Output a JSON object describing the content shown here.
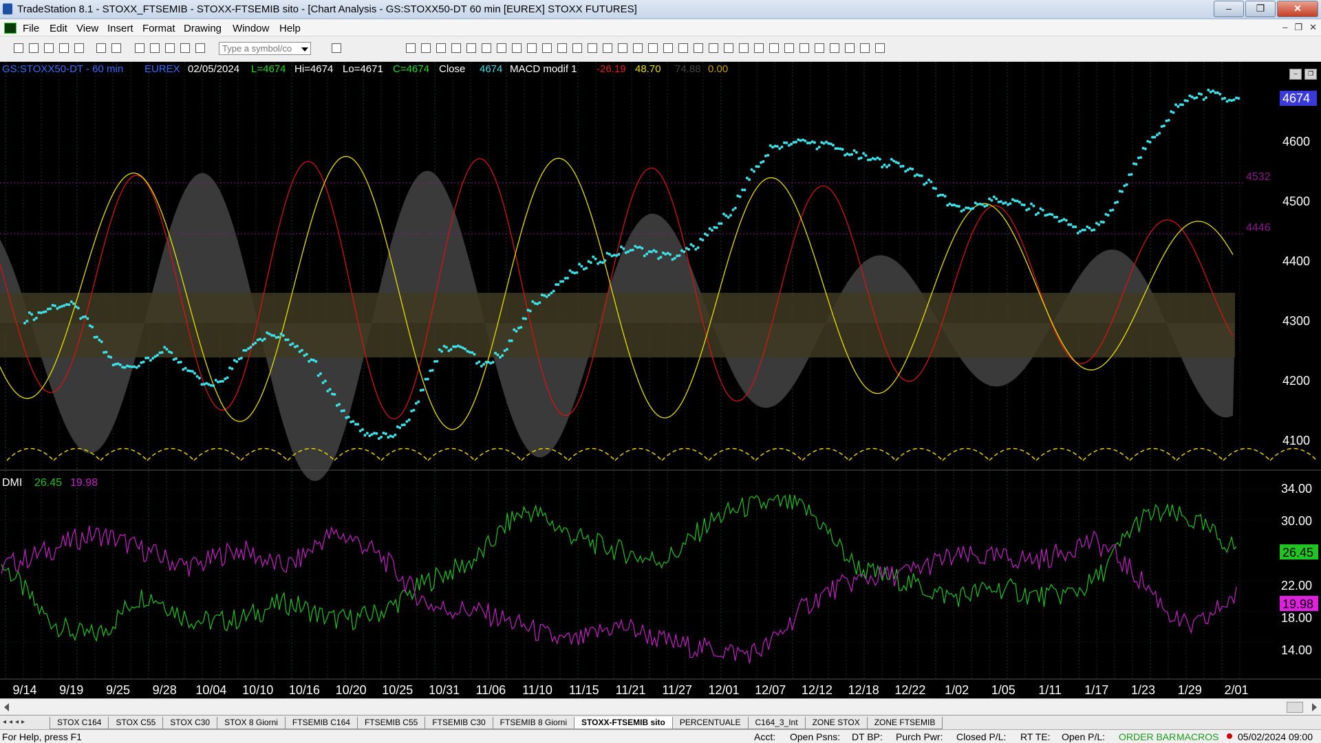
{
  "window": {
    "title": "TradeStation 8.1 - STOXX_FTSEMIB - STOXX-FTSEMIB sito - [Chart Analysis - GS:STOXX50-DT  60 min  [EUREX] STOXX FUTURES]",
    "minimize": "–",
    "restore": "❐",
    "close": "✕"
  },
  "menu": {
    "items": [
      "File",
      "Edit",
      "View",
      "Insert",
      "Format",
      "Drawing",
      "Window",
      "Help"
    ],
    "mdi_minimize": "–",
    "mdi_restore": "❐",
    "mdi_close": "✕"
  },
  "toolbar": {
    "symbol_placeholder": "Type a symbol/co"
  },
  "chart": {
    "header": {
      "symbol_interval": "GS:STOXX50-DT - 60 min",
      "exchange": "EUREX",
      "date": "02/05/2024",
      "last": "L=4674",
      "high": "Hi=4674",
      "low": "Lo=4671",
      "close_value": "C=4674",
      "close_label": "Close",
      "close_price": "4674",
      "macd_label": "MACD modif 1",
      "macd_v1": "-26.19",
      "macd_v2": "48.70",
      "macd_v3": "74.88",
      "macd_v4": "0.00"
    },
    "colors": {
      "price": "#3fe0e8",
      "macd_red": "#d41414",
      "macd_yellow": "#e8e000",
      "histogram": "#3a3a3a",
      "dmi_plus": "#22c422",
      "dmi_minus": "#c422c4",
      "level_line": "#9a1a9a"
    },
    "price_axis": {
      "ticks": [
        "4600",
        "4500",
        "4400",
        "4300",
        "4200",
        "4100"
      ],
      "last_price_tag": "4674",
      "level_high": "4532",
      "level_low": "4446"
    },
    "dmi": {
      "label": "DMI",
      "plus_value": "26.45",
      "minus_value": "19.98",
      "axis_ticks": [
        "34.00",
        "30.00",
        "22.00",
        "18.00",
        "14.00"
      ]
    },
    "x_axis": {
      "labels": [
        "9/14",
        "9/19",
        "9/25",
        "9/28",
        "10/04",
        "10/10",
        "10/16",
        "10/20",
        "10/25",
        "10/31",
        "11/06",
        "11/10",
        "11/15",
        "11/21",
        "11/27",
        "12/01",
        "12/07",
        "12/12",
        "12/18",
        "12/22",
        "1/02",
        "1/05",
        "1/11",
        "1/17",
        "1/23",
        "1/29",
        "2/01"
      ]
    }
  },
  "chart_data": {
    "type": "line",
    "x": [
      "9/14",
      "9/19",
      "9/25",
      "9/28",
      "10/04",
      "10/10",
      "10/16",
      "10/20",
      "10/25",
      "10/31",
      "11/06",
      "11/10",
      "11/15",
      "11/21",
      "11/27",
      "12/01",
      "12/07",
      "12/12",
      "12/18",
      "12/22",
      "1/02",
      "1/05",
      "1/11",
      "1/17",
      "1/23",
      "1/29",
      "2/01"
    ],
    "price_series": {
      "name": "Close",
      "values": [
        4290,
        4310,
        4205,
        4230,
        4170,
        4255,
        4230,
        4110,
        4095,
        4235,
        4215,
        4320,
        4380,
        4410,
        4400,
        4465,
        4585,
        4595,
        4570,
        4550,
        4485,
        4495,
        4470,
        4450,
        4585,
        4675,
        4674
      ]
    },
    "price_ylim": [
      4040,
      4720
    ],
    "dmi_series": [
      {
        "name": "DMI+",
        "values": [
          24,
          17,
          15,
          20,
          17,
          17,
          19,
          17,
          18,
          22,
          25,
          31,
          28,
          26,
          25,
          30,
          32,
          31,
          24,
          22,
          20,
          21,
          20,
          22,
          30,
          30,
          26.45
        ]
      },
      {
        "name": "DMI-",
        "values": [
          24,
          26,
          28,
          26,
          24,
          26,
          24,
          28,
          25,
          19,
          18,
          16,
          14,
          16,
          14,
          13,
          13,
          19,
          22,
          23,
          25,
          25,
          25,
          27,
          22,
          16,
          19.98
        ]
      }
    ],
    "dmi_ylim": [
      10,
      36
    ]
  },
  "tabs": {
    "nav": "◂◂◂▸",
    "items": [
      "STOX C164",
      "STOX C55",
      "STOX  C30",
      "STOX  8 Giorni",
      "FTSEMIB C164",
      "FTSEMIB C55",
      "FTSEMIB C30",
      "FTSEMIB  8 Giorni",
      "STOXX-FTSEMIB sito",
      "PERCENTUALE",
      "C164_3_Int",
      "ZONE STOX",
      "ZONE FTSEMIB"
    ],
    "active_index": 8
  },
  "status": {
    "help": "For Help, press F1",
    "acct": "Acct:",
    "open_psns": "Open Psns:",
    "dt_bp": "DT BP:",
    "purch_pwr": "Purch Pwr:",
    "closed_pl": "Closed P/L:",
    "rt_te": "RT TE:",
    "open_pl": "Open P/L:",
    "order_bar": "ORDER BAR",
    "macros": "MACROS",
    "datetime": "05/02/2024 09:00"
  }
}
